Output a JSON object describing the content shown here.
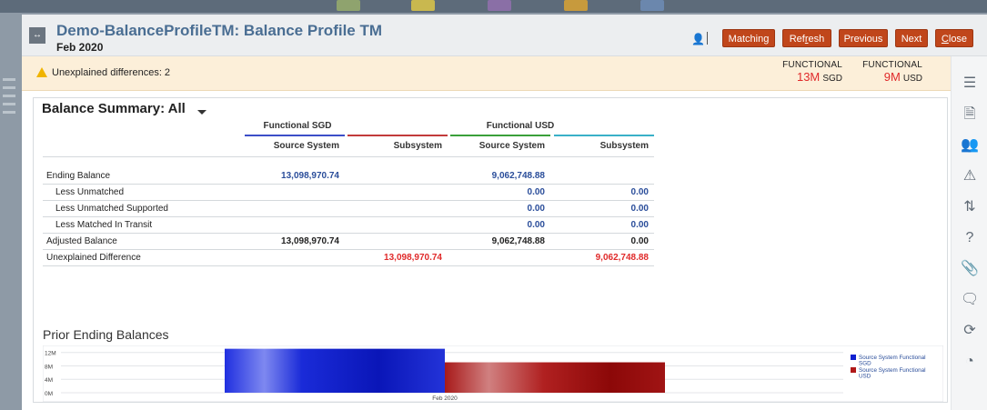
{
  "header": {
    "title": "Demo-BalanceProfileTM: Balance Profile TM",
    "period": "Feb 2020",
    "buttons": {
      "matching": "Matching",
      "refresh": "Refresh",
      "previous": "Previous",
      "next": "Next",
      "close": "Close"
    }
  },
  "alert": {
    "text": "Unexplained differences: 2",
    "metrics": [
      {
        "label": "FUNCTIONAL",
        "value": "13M",
        "currency": "SGD"
      },
      {
        "label": "FUNCTIONAL",
        "value": "9M",
        "currency": "USD"
      }
    ]
  },
  "summary": {
    "title": "Balance Summary: All",
    "groups": [
      "Functional SGD",
      "Functional USD"
    ],
    "columns": [
      "Source System",
      "Subsystem",
      "Source System",
      "Subsystem"
    ],
    "rows": [
      {
        "label": "Ending Balance",
        "indent": false,
        "cells": [
          "13,098,970.74",
          "",
          "9,062,748.88",
          ""
        ],
        "color": "blue"
      },
      {
        "label": "Less Unmatched",
        "indent": true,
        "cells": [
          "",
          "",
          "0.00",
          "0.00"
        ],
        "color": "blue"
      },
      {
        "label": "Less Unmatched Supported",
        "indent": true,
        "cells": [
          "",
          "",
          "0.00",
          "0.00"
        ],
        "color": "blue"
      },
      {
        "label": "Less Matched In Transit",
        "indent": true,
        "cells": [
          "",
          "",
          "0.00",
          "0.00"
        ],
        "color": "blue"
      },
      {
        "label": "Adjusted Balance",
        "indent": false,
        "cells": [
          "13,098,970.74",
          "",
          "9,062,748.88",
          "0.00"
        ],
        "color": "black"
      },
      {
        "label": "Unexplained Difference",
        "indent": false,
        "cells": [
          "",
          "13,098,970.74",
          "",
          "9,062,748.88"
        ],
        "color": "red"
      }
    ]
  },
  "prior": {
    "title": "Prior Ending Balances"
  },
  "chart_data": {
    "type": "bar",
    "categories": [
      "Feb 2020"
    ],
    "series": [
      {
        "name": "Source System Functional SGD",
        "values": [
          13098970.74
        ],
        "color": "#1020d0"
      },
      {
        "name": "Source System Functional USD",
        "values": [
          9062748.88
        ],
        "color": "#b01818"
      }
    ],
    "yticks": [
      "0M",
      "4M",
      "8M",
      "12M"
    ],
    "ylim": [
      0,
      13000000
    ],
    "legend_position": "right"
  },
  "colors": {
    "accent": "#c0461b",
    "title": "#4a6e93",
    "alert_bg": "#fcefd9",
    "value_blue": "#2a4d9a",
    "value_red": "#e02a2a"
  }
}
